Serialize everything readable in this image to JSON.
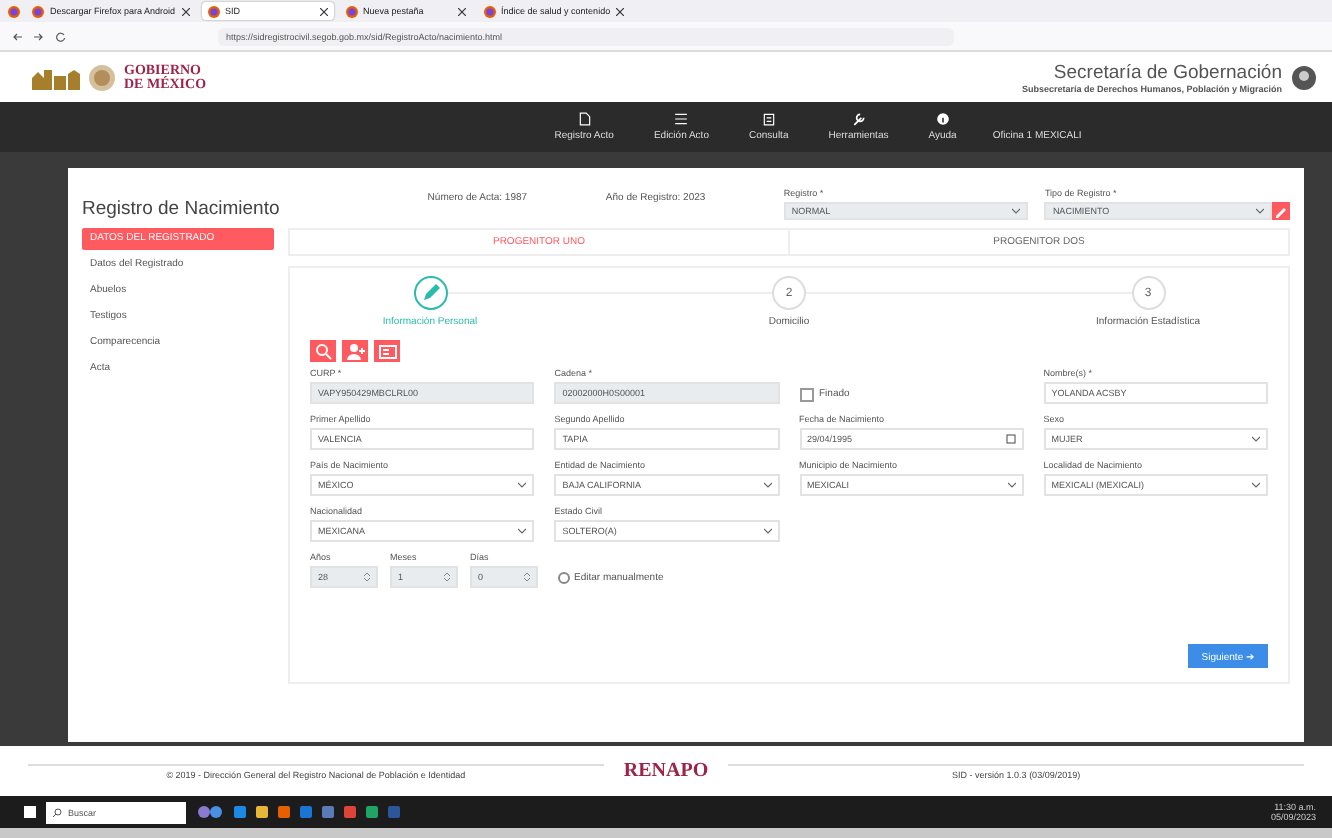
{
  "browser": {
    "tabs": [
      {
        "title": "Descargar Firefox para Android",
        "selected": false
      },
      {
        "title": "SID",
        "selected": true
      },
      {
        "title": "Nueva pestaña",
        "selected": false
      },
      {
        "title": "Índice de salud y contenido",
        "selected": false
      }
    ],
    "address": "https://sidregistrocivil.segob.gob.mx/sid/RegistroActo/nacimiento.html"
  },
  "header": {
    "logo": "GOBIERNO DE MÉXICO",
    "title": "Secretaría de Gobernación",
    "subtitle": "Subsecretaría de Derechos Humanos, Población y Migración"
  },
  "nav": {
    "items": [
      {
        "label": "Registro Acto"
      },
      {
        "label": "Edición Acto"
      },
      {
        "label": "Consulta"
      },
      {
        "label": "Herramientas"
      },
      {
        "label": "Ayuda"
      }
    ],
    "office": "Oficina 1 MEXICALI"
  },
  "card": {
    "title": "Registro de Nacimiento",
    "sidebar": [
      {
        "label": "DATOS DEL REGISTRADO",
        "selected": true
      },
      {
        "label": "Datos del Registrado",
        "selected": false
      },
      {
        "label": "Abuelos",
        "selected": false
      },
      {
        "label": "Testigos",
        "selected": false
      },
      {
        "label": "Comparecencia",
        "selected": false
      },
      {
        "label": "Acta",
        "selected": false
      }
    ],
    "acta": "Número de Acta: 1987",
    "anio": "Año de Registro: 2023",
    "registro": {
      "label": "Registro *",
      "value": "NORMAL"
    },
    "tipo": {
      "label": "Tipo de Registro *",
      "value": "NACIMIENTO"
    },
    "tabs": [
      {
        "label": "PROGENITOR UNO",
        "selected": true
      },
      {
        "label": "PROGENITOR DOS",
        "selected": false
      }
    ],
    "steps": [
      {
        "label": "Información Personal",
        "selected": true
      },
      {
        "number": "2",
        "label": "Domicilio",
        "selected": false
      },
      {
        "number": "3",
        "label": "Información Estadística",
        "selected": false
      }
    ],
    "rows": [
      [
        {
          "kind": "text",
          "label": "CURP *",
          "value": "VAPY950429MBCLRL00",
          "disabled": true
        },
        {
          "kind": "text",
          "label": "Cadena *",
          "value": "02002000H0S00001",
          "disabled": true
        },
        {
          "kind": "check",
          "label": "Finado",
          "checked": false
        },
        {
          "kind": "text",
          "label": "Nombre(s) *",
          "value": "YOLANDA ACSBY",
          "disabled": false
        }
      ],
      [
        {
          "kind": "text",
          "label": "Primer Apellido",
          "value": "VALENCIA",
          "disabled": false
        },
        {
          "kind": "text",
          "label": "Segundo Apellido",
          "value": "TAPIA",
          "disabled": false
        },
        {
          "kind": "date",
          "label": "Fecha de Nacimiento",
          "value": "29/04/1995",
          "disabled": false
        },
        {
          "kind": "select",
          "label": "Sexo",
          "value": "MUJER",
          "disabled": false
        }
      ],
      [
        {
          "kind": "select",
          "label": "País de Nacimiento",
          "value": "MÉXICO",
          "disabled": false
        },
        {
          "kind": "select",
          "label": "Entidad de Nacimiento",
          "value": "BAJA CALIFORNIA",
          "disabled": false
        },
        {
          "kind": "select",
          "label": "Municipio de Nacimiento",
          "value": "MEXICALI",
          "disabled": false
        },
        {
          "kind": "select",
          "label": "Localidad de Nacimiento",
          "value": "MEXICALI (MEXICALI)",
          "disabled": false
        }
      ],
      [
        {
          "kind": "select",
          "label": "Nacionalidad",
          "value": "MEXICANA",
          "disabled": false
        },
        {
          "kind": "select",
          "label": "Estado Civil",
          "value": "SOLTERO(A)",
          "disabled": false
        }
      ]
    ],
    "age": [
      {
        "label": "Años",
        "value": "28"
      },
      {
        "label": "Meses",
        "value": "1"
      },
      {
        "label": "Días",
        "value": "0"
      }
    ],
    "manual": {
      "label": "Editar manualmente",
      "selected": false
    },
    "next": "Siguiente ➔"
  },
  "footer": {
    "copyright": "© 2019 - Dirección General del Registro Nacional de Población e Identidad",
    "brand": "RENAPO",
    "version": "SID - versión 1.0.3 (03/09/2019)"
  },
  "taskbar": {
    "search": "Buscar",
    "time": "11:30 a.m.",
    "date": "05/09/2023"
  }
}
